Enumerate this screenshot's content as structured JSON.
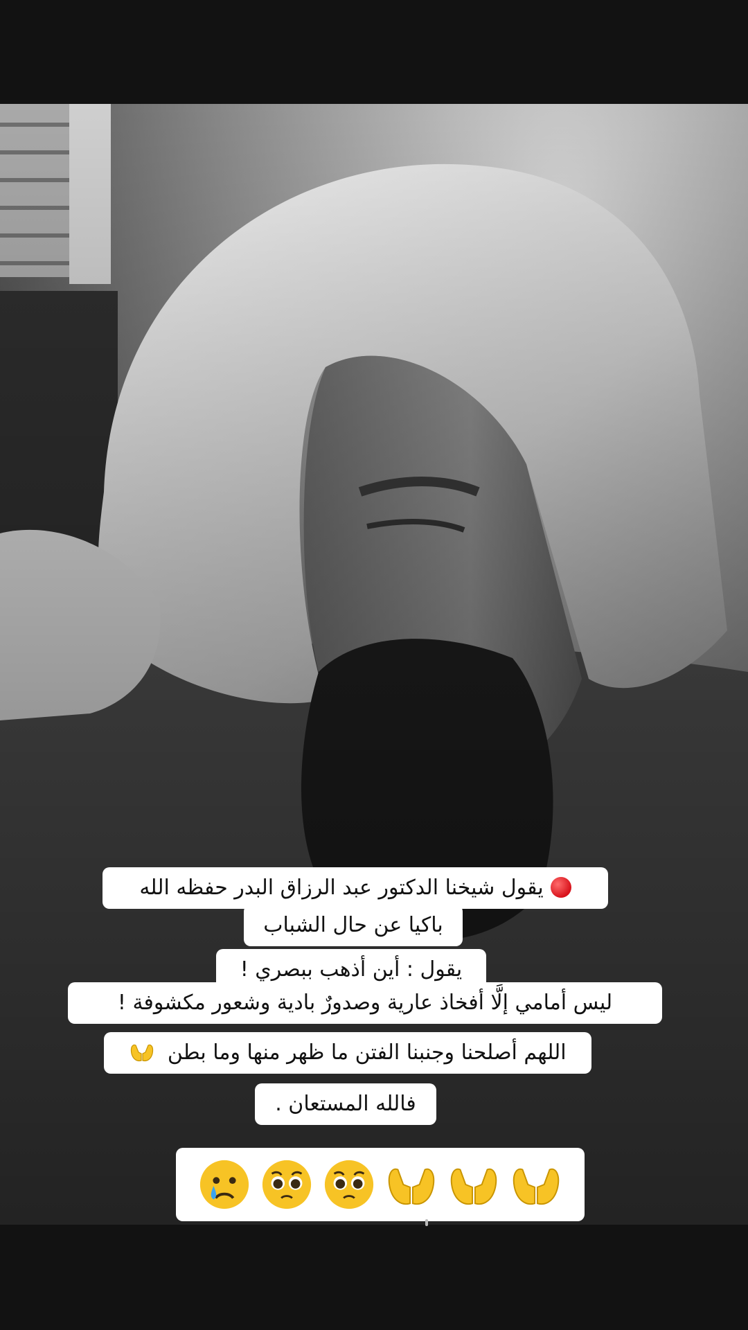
{
  "caption": {
    "lines": [
      "يقول شيخنا الدكتور عبد الرزاق البدر حفظه الله",
      "باكيا عن حال الشباب",
      "يقول : أين أذهب ببصري !",
      "ليس أمامي إلَّا أفخاذ عارية وصدورٌ بادية وشعور مكشوفة !",
      "اللهم أصلحنا وجنبنا الفتن ما ظهر منها وما بطن",
      "فالله المستعان ."
    ],
    "line1_icon": "red-circle-emoji",
    "line5_icon": "palms-up-together-emoji"
  },
  "emoji_row": {
    "items": [
      "palms-up-together-emoji",
      "palms-up-together-emoji",
      "palms-up-together-emoji",
      "pleading-face-emoji",
      "pleading-face-emoji",
      "crying-face-emoji"
    ]
  },
  "colors": {
    "caption_bg": "#ffffff",
    "caption_text": "#111111",
    "letterbox": "#121212",
    "red_dot": "#d8121b",
    "emoji_yellow": "#f7c325"
  }
}
